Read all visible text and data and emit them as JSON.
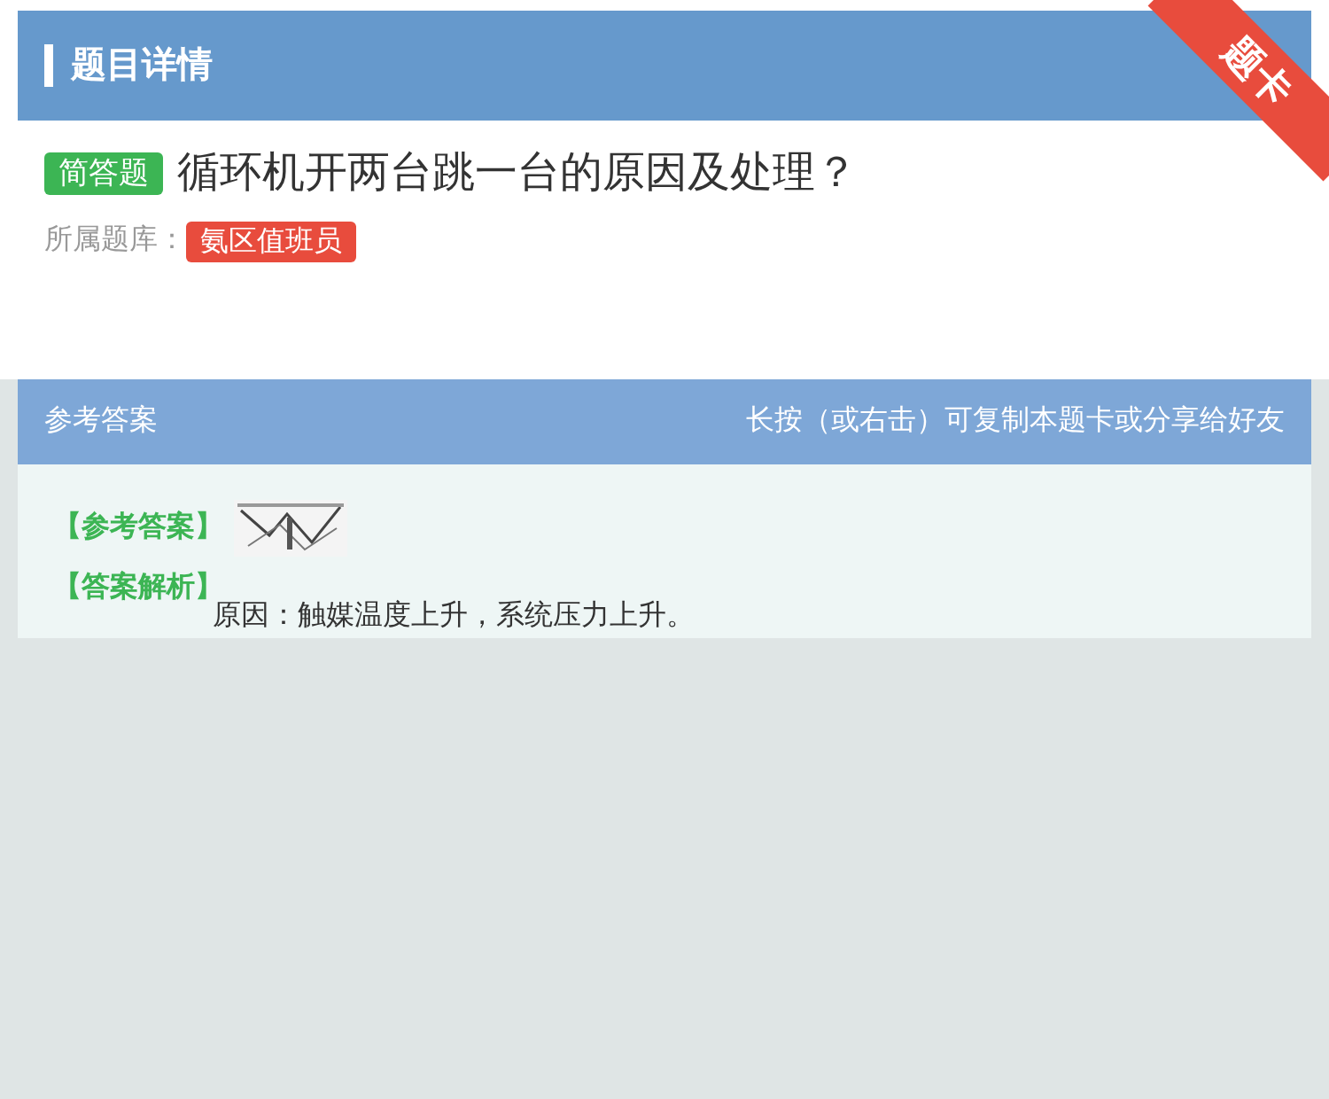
{
  "header": {
    "title": "题目详情",
    "ribbon": "题卡"
  },
  "question": {
    "type_badge": "简答题",
    "text": "循环机开两台跳一台的原因及处理？",
    "bank_label": "所属题库：",
    "bank": "氨区值班员"
  },
  "answer_bar": {
    "title": "参考答案",
    "hint": "长按（或右击）可复制本题卡或分享给好友"
  },
  "answer": {
    "answer_label": "【参考答案】",
    "analysis_label": "【答案解析】",
    "analysis": "原因：触媒温度上升，系统压力上升。"
  }
}
